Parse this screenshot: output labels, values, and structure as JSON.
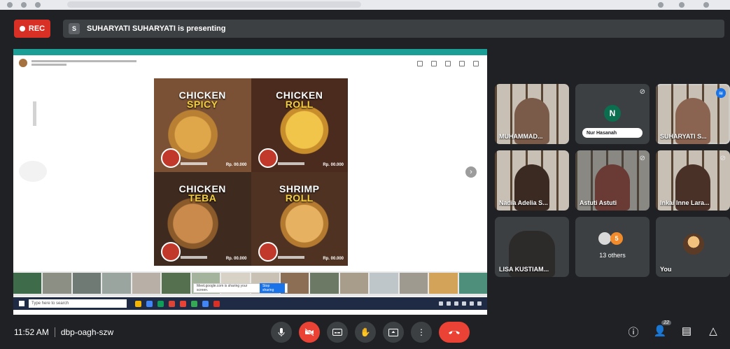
{
  "browser": {},
  "recording": {
    "label": "REC"
  },
  "presentation": {
    "banner": "SUHARYATI SUHARYATI is presenting",
    "presenter_initial": "S"
  },
  "shared_screen": {
    "menu_items": [
      {
        "title": "CHICKEN",
        "subtitle": "SPICY",
        "price": "Rp. 00.000"
      },
      {
        "title": "CHICKEN",
        "subtitle": "ROLL",
        "price": "Rp. 00.000"
      },
      {
        "title": "CHICKEN",
        "subtitle": "TEBA",
        "price": "Rp. 00.000"
      },
      {
        "title": "SHRIMP",
        "subtitle": "ROLL",
        "price": "Rp. 00.000"
      }
    ],
    "popup_text": "Meet.google.com is sharing your screen.",
    "popup_button": "Stop sharing",
    "taskbar_search": "Type here to search"
  },
  "participants": [
    {
      "name": "MUHAMMAD...",
      "type": "video"
    },
    {
      "name": "Nur Hasanah",
      "initial": "N",
      "type": "avatar",
      "muted": true
    },
    {
      "name": "SUHARYATI S...",
      "type": "video",
      "speaking": true
    },
    {
      "name": "Nadia Adelia S...",
      "type": "video"
    },
    {
      "name": "Astuti Astuti",
      "type": "video",
      "muted": true
    },
    {
      "name": "Inkai Inne Lara...",
      "type": "video",
      "muted": true
    },
    {
      "name": "LISA KUSTIAM...",
      "type": "video"
    },
    {
      "name": "13 others",
      "count_badge": "5",
      "type": "others"
    },
    {
      "name": "You",
      "type": "self"
    }
  ],
  "meeting": {
    "time": "11:52 AM",
    "code": "dbp-oagh-szw"
  },
  "controls": {
    "mic_icon": "microphone-icon",
    "camera_icon": "camera-off-icon",
    "captions_icon": "captions-icon",
    "hand_icon": "raise-hand-icon",
    "present_icon": "present-screen-icon",
    "more_icon": "more-options-icon",
    "end_icon": "end-call-icon"
  },
  "right_panel": {
    "people_count": "22"
  },
  "colors": {
    "rec": "#d93025",
    "end_call": "#ea4335",
    "background": "#202124",
    "tile": "#3c4043",
    "accent": "#8ab4f8"
  }
}
